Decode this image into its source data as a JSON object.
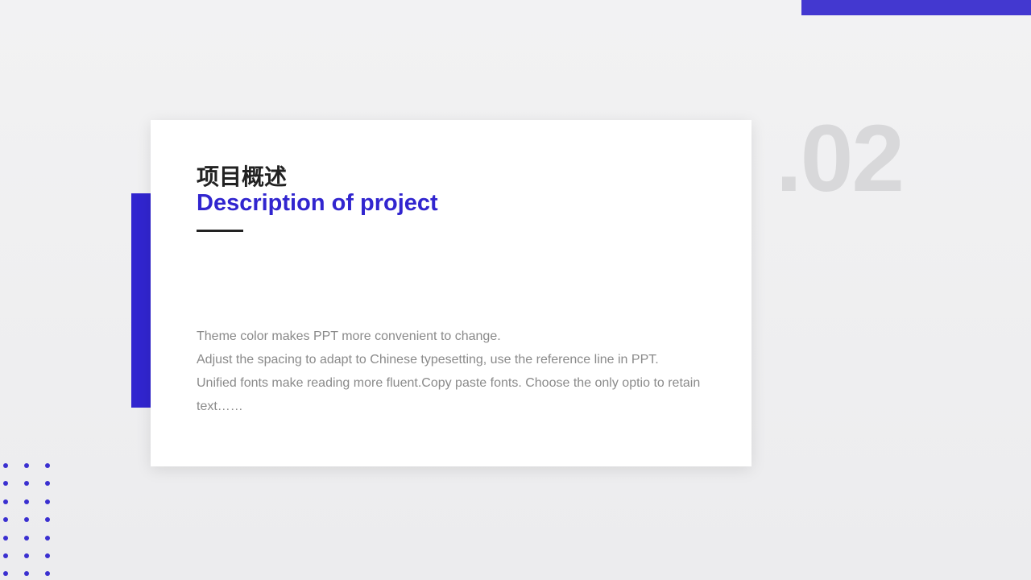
{
  "slide": {
    "title_cn": "项目概述",
    "title_en": "Description of project",
    "body_lines": [
      "Theme  color makes PPT more convenient to change.",
      "Adjust the spacing to adapt to Chinese typesetting, use the reference line in PPT.",
      "Unified fonts make reading more fluent.Copy paste fonts. Choose the only optio to retain text……"
    ],
    "number": ".02"
  },
  "colors": {
    "accent": "#3125cf",
    "accent_top_bar": "#4338d0",
    "dot": "#3a2fd0"
  },
  "decorations": {
    "dot_rows": 7,
    "dot_cols": 3
  }
}
